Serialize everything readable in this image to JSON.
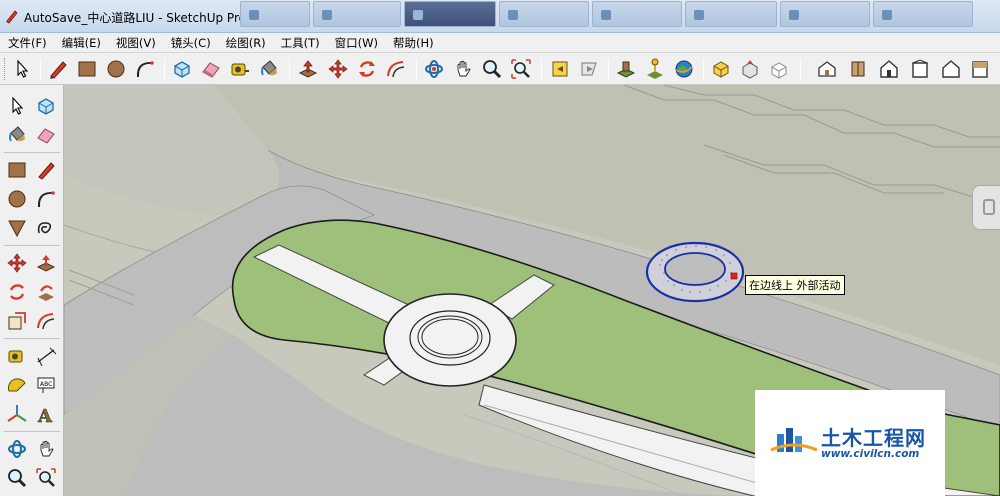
{
  "window": {
    "title": "AutoSave_中心道路LIU - SketchUp Pro"
  },
  "menu": {
    "items": [
      "文件(F)",
      "编辑(E)",
      "视图(V)",
      "镜头(C)",
      "绘图(R)",
      "工具(T)",
      "窗口(W)",
      "帮助(H)"
    ]
  },
  "toolbar": {
    "icons": [
      "select-icon",
      "pencil-icon",
      "rectangle-icon",
      "circle-icon",
      "arc-icon",
      "make-component-icon",
      "eraser-icon",
      "tape-measure-icon",
      "paint-bucket-icon",
      "push-pull-icon",
      "move-icon",
      "rotate-icon",
      "offset-icon",
      "orbit-icon",
      "pan-icon",
      "zoom-icon",
      "zoom-extents-icon",
      "previous-view-icon",
      "next-view-icon",
      "add-location-icon",
      "toggle-terrain-icon",
      "google-earth-icon",
      "get-models-icon",
      "share-model-icon",
      "share-component-icon",
      "iso-view-icon",
      "top-view-icon",
      "front-view-icon",
      "right-view-icon",
      "back-view-icon",
      "left-view-icon"
    ]
  },
  "tooltip": {
    "text": "在边线上 外部活动"
  },
  "watermark": {
    "name": "土木工程网",
    "url": "www.civilcn.com"
  },
  "colors": {
    "ground": "#c8c9bd",
    "road": "#bdbdbd",
    "grass": "#9fc07a",
    "sidewalk": "#f2f2f2",
    "selection": "#1c2fa8",
    "brand": "#1a56a8"
  }
}
